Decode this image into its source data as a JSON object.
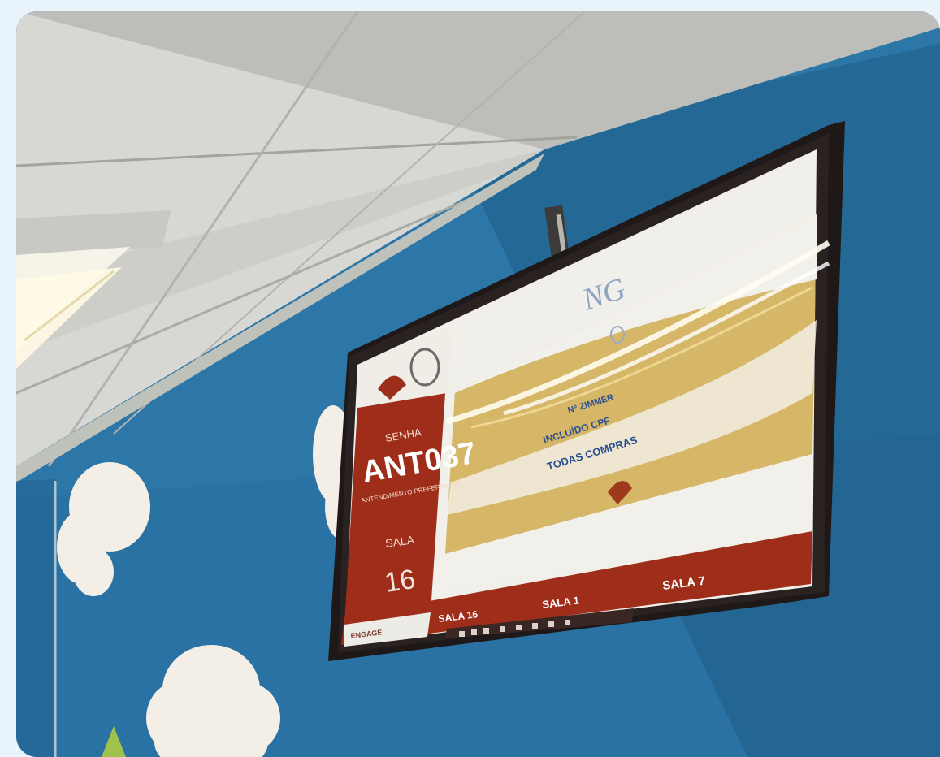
{
  "display": {
    "brand_logo": "NG",
    "panel_label": "SENHA",
    "ticket_code": "ANT037",
    "ticket_desc": "ANTENDIMENTO PREFERENCIAL",
    "room_label": "SALA",
    "room_number": "16",
    "promo_line1": "Nº ZIMMER",
    "promo_line2": "INCLUÍDO CPF",
    "promo_line3": "TODAS COMPRAS",
    "history": [
      "SALA 16",
      "SALA 1",
      "SALA 7"
    ],
    "footer_badge": "ENGAGE"
  },
  "colors": {
    "wall": "#2d78a8",
    "ceiling": "#d9dbd7",
    "tv_bezel": "#241c1c",
    "panel_red": "#a8321b",
    "promo_gold": "#d8b86a",
    "screen_white": "#f3f1ec"
  }
}
